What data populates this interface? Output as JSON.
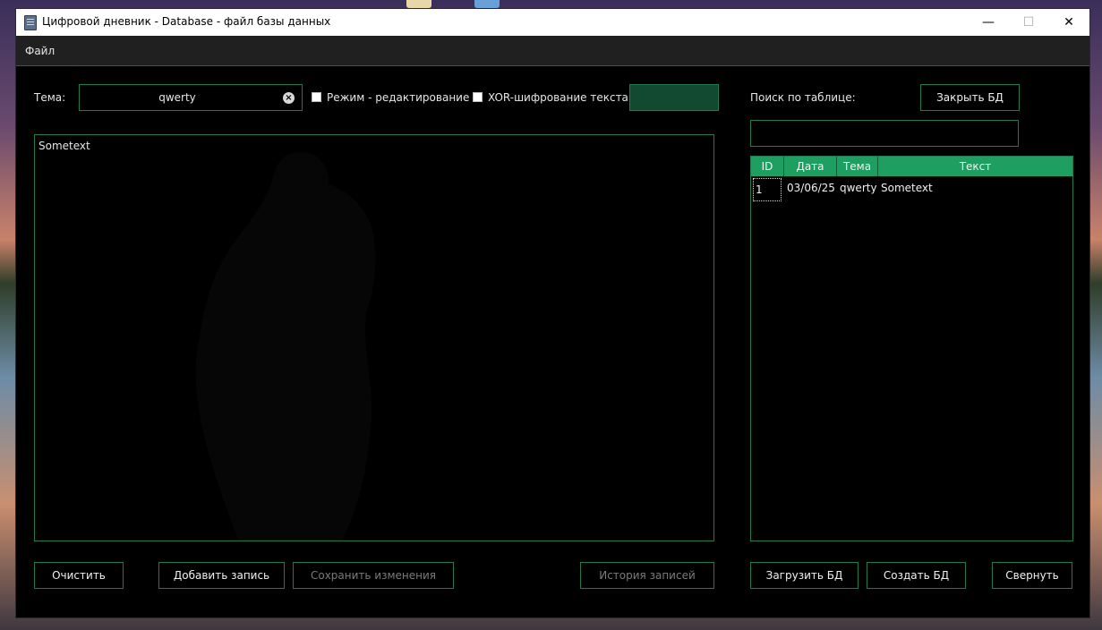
{
  "window": {
    "title": "Цифровой дневник - Database - файл базы данных",
    "controls": {
      "minimize": "—",
      "maximize": "☐",
      "close": "✕"
    }
  },
  "menu": {
    "file": "Файл"
  },
  "editor": {
    "topic_label": "Тема:",
    "topic_value": "qwerty",
    "edit_mode_label": "Режим - редактирование",
    "edit_mode_checked": false,
    "xor_label": "XOR-шифрование текста",
    "xor_checked": false,
    "text": "Sometext"
  },
  "search": {
    "label": "Поиск по таблице:",
    "value": "",
    "close_db_button": "Закрыть БД"
  },
  "table": {
    "headers": [
      "ID",
      "Дата",
      "Тема",
      "Текст"
    ],
    "rows": [
      {
        "id": "1",
        "date": "03/06/25",
        "topic": "qwerty",
        "text": "Sometext"
      }
    ]
  },
  "buttons": {
    "clear": "Очистить",
    "add_record": "Добавить запись",
    "save_changes": "Сохранить изменения",
    "history": "История записей",
    "load_db": "Загрузить БД",
    "create_db": "Создать БД",
    "minimize": "Свернуть"
  },
  "colors": {
    "accent": "#1f7a4d",
    "header_green": "#1f9e61",
    "indicator_green": "#114a30",
    "background": "#000000"
  }
}
